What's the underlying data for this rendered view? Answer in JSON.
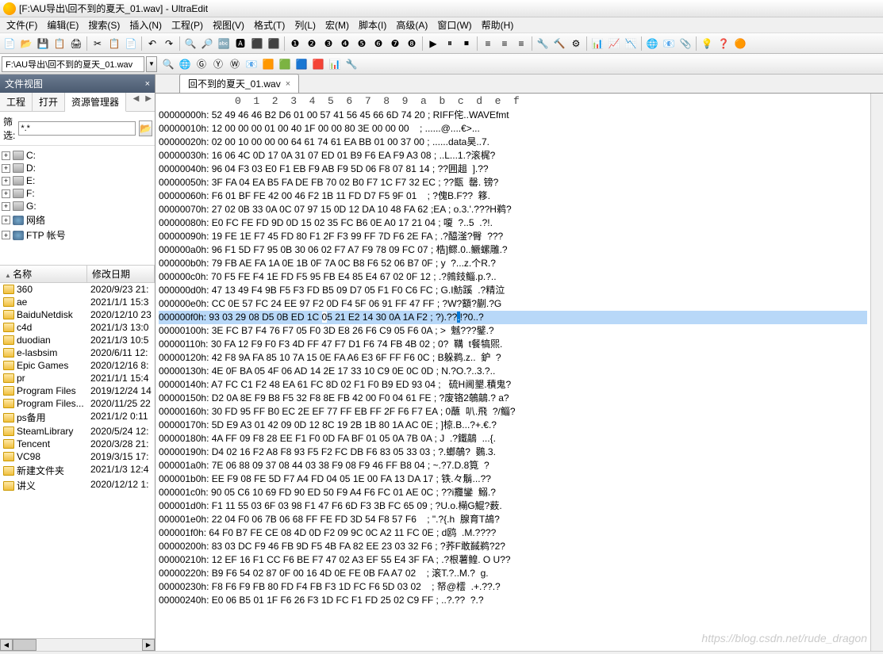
{
  "title": "[F:\\AU导出\\回不到的夏天_01.wav] - UltraEdit",
  "menu": [
    "文件(F)",
    "编辑(E)",
    "搜索(S)",
    "插入(N)",
    "工程(P)",
    "视图(V)",
    "格式(T)",
    "列(L)",
    "宏(M)",
    "脚本(I)",
    "高级(A)",
    "窗口(W)",
    "帮助(H)"
  ],
  "pathbox": "F:\\AU导出\\回不到的夏天_01.wav",
  "sidebar": {
    "title": "文件视图",
    "tabs": [
      "工程",
      "打开",
      "资源管理器"
    ],
    "filter_label": "筛选:",
    "filter_value": "*.*",
    "drives": [
      {
        "label": "C:",
        "icon": "drive"
      },
      {
        "label": "D:",
        "icon": "drive"
      },
      {
        "label": "E:",
        "icon": "drive"
      },
      {
        "label": "F:",
        "icon": "drive"
      },
      {
        "label": "G:",
        "icon": "drive"
      },
      {
        "label": "网络",
        "icon": "net"
      },
      {
        "label": "FTP 帐号",
        "icon": "net"
      }
    ],
    "list_hdr": [
      "名称",
      "修改日期"
    ],
    "files": [
      {
        "n": "360",
        "d": "2020/9/23 21:"
      },
      {
        "n": "ae",
        "d": "2021/1/1 15:3"
      },
      {
        "n": "BaiduNetdisk",
        "d": "2020/12/10 23"
      },
      {
        "n": "c4d",
        "d": "2021/1/3 13:0"
      },
      {
        "n": "duodian",
        "d": "2021/1/3 10:5"
      },
      {
        "n": "e-lasbsim",
        "d": "2020/6/11 12:"
      },
      {
        "n": "Epic Games",
        "d": "2020/12/16 8:"
      },
      {
        "n": "pr",
        "d": "2021/1/1 15:4"
      },
      {
        "n": "Program Files",
        "d": "2019/12/24 14"
      },
      {
        "n": "Program Files...",
        "d": "2020/11/25 22"
      },
      {
        "n": "ps备用",
        "d": "2021/1/2 0:11"
      },
      {
        "n": "SteamLibrary",
        "d": "2020/5/24 12:"
      },
      {
        "n": "Tencent",
        "d": "2020/3/28 21:"
      },
      {
        "n": "VC98",
        "d": "2019/3/15 17:"
      },
      {
        "n": "新建文件夹",
        "d": "2021/1/3 12:4"
      },
      {
        "n": "讲义",
        "d": "2020/12/12 1:"
      }
    ]
  },
  "editor": {
    "tab": "回不到的夏天_01.wav",
    "cols": "0  1  2  3  4  5  6  7  8  9  a  b  c  d  e  f",
    "highlight_row": 15,
    "lines": [
      {
        "a": "00000000h:",
        "h": "52 49 46 46 B2 D6 01 00 57 41 56 45 66 6D 74 20",
        "t": "; RIFF侘..WAVEfmt "
      },
      {
        "a": "00000010h:",
        "h": "12 00 00 00 01 00 40 1F 00 00 80 3E 00 00 00   ",
        "t": "; ......@....€>..."
      },
      {
        "a": "00000020h:",
        "h": "02 00 10 00 00 00 64 61 74 61 EA BB 01 00 37 00",
        "t": "; ......data昊..7."
      },
      {
        "a": "00000030h:",
        "h": "16 06 4C 0D 17 0A 31 07 ED 01 B9 F6 EA F9 A3 08",
        "t": "; ..L...1.?滚梶?"
      },
      {
        "a": "00000040h:",
        "h": "96 04 F3 03 E0 F1 EB F9 AB F9 5D 06 F8 07 81 14",
        "t": "; ??囲趄  ].??"
      },
      {
        "a": "00000050h:",
        "h": "3F FA 04 EA B5 FA DE FB 70 02 B0 F7 1C F7 32 EC",
        "t": "; ??甑  罄. 镑?"
      },
      {
        "a": "00000060h:",
        "h": "F6 01 BF FE 42 00 46 F2 1B 11 FD D7 F5 9F 01   ",
        "t": "; ?傀B.F??  簃."
      },
      {
        "a": "00000070h:",
        "h": "27 02 0B 33 0A 0C 07 97 15 0D 12 DA 10 48 FA 62",
        "t": ";EA ; o.3.'.???H鹈?"
      },
      {
        "a": "00000080h:",
        "h": "E0 FC FE FD 9D 0D 15 02 35 FC B6 0E A0 17 21 04",
        "t": "; 嗄  ?..5  .?!."
      },
      {
        "a": "00000090h:",
        "h": "19 FE 1E F7 45 FD 80 F1 2F F3 99 FF 7D F6 2E FA",
        "t": "; .?醯滏?臀  ???"
      },
      {
        "a": "000000a0h:",
        "h": "96 F1 5D F7 95 0B 30 06 02 F7 A7 F9 78 09 FC 07",
        "t": "; 梏]鳏.0..鳜螺雕.?"
      },
      {
        "a": "000000b0h:",
        "h": "79 FB AE FA 1A 0E 1B 0F 7A 0C B8 F6 52 06 B7 0F",
        "t": "; y  ?...z.个R.?"
      },
      {
        "a": "000000c0h:",
        "h": "70 F5 FE F4 1E FD F5 95 FB E4 85 E4 67 02 0F 12",
        "t": "; .?鶁鈘鲻.p.?.."
      },
      {
        "a": "000000d0h:",
        "h": "47 13 49 F4 9B F5 F3 FD B5 09 D7 05 F1 F0 C6 FC",
        "t": "; G.I魴蹊  .?精泣"
      },
      {
        "a": "000000e0h:",
        "h": "CC 0E 57 FC 24 EE 97 F2 0D F4 5F 06 91 FF 47 FF",
        "t": "; ?W?顮?蒯.?G"
      },
      {
        "a": "000000f0h:",
        "h": "93 03 29 08 D5 0B ED 1C 05 21 E2 14 30 0A 1A F2",
        "t": "; ?).??.!?0..?",
        "sel_before": "93 03 29 08 D5 0B ED 1C ",
        "sel_cell": "0",
        "sel_after": "5 21 E2 14 30 0A 1A F2"
      },
      {
        "a": "00000100h:",
        "h": "3E FC B7 F4 76 F7 05 F0 3D E8 26 F6 C9 05 F6 0A",
        "t": "; >  魊???鐾.?"
      },
      {
        "a": "00000110h:",
        "h": "30 FA 12 F9 F0 F3 4D FF 47 F7 D1 F6 74 FB 4B 02",
        "t": "; 0?  鞲  t餐犒煕."
      },
      {
        "a": "00000120h:",
        "h": "42 F8 9A FA 85 10 7A 15 0E FA A6 E3 6F FF F6 0C",
        "t": "; B躲鹈.z..  鈩  ?"
      },
      {
        "a": "00000130h:",
        "h": "4E 0F BA 05 4F 06 AD 14 2E 17 33 10 C9 0E 0C 0D",
        "t": "; N.?O.?..3.?.."
      },
      {
        "a": "00000140h:",
        "h": "A7 FC C1 F2 48 EA 61 FC 8D 02 F1 F0 B9 ED 93 04",
        "t": ";   硫H阃墾.積鬼?"
      },
      {
        "a": "00000150h:",
        "h": "D2 0A 8E F9 B8 F5 32 F8 8E FB 42 00 F0 04 61 FE",
        "t": "; ?废铬2鵸鶮.? a?"
      },
      {
        "a": "00000160h:",
        "h": "30 FD 95 FF B0 EC 2E EF 77 FF EB FF 2F F6 F7 EA",
        "t": "; 0蘸  叭.飛  ?/鲻?"
      },
      {
        "a": "00000170h:",
        "h": "5D E9 A3 01 42 09 0D 12 8C 19 2B 1B 80 1A AC 0E",
        "t": "; ]椋.B...?+.€.?"
      },
      {
        "a": "00000180h:",
        "h": "4A FF 09 F8 28 EE F1 F0 0D FA BF 01 05 0A 7B 0A",
        "t": "; J  .?鐵鶮  ...{."
      },
      {
        "a": "00000190h:",
        "h": "D4 02 16 F2 A8 F8 93 F5 F2 FC DB F6 83 05 33 03",
        "t": "; ?.螂鵸?  鷃.3."
      },
      {
        "a": "000001a0h:",
        "h": "7E 06 88 09 37 08 44 03 38 F9 08 F9 46 FF B8 04",
        "t": "; ~.?7.D.8筧  ?"
      },
      {
        "a": "000001b0h:",
        "h": "EE F9 08 FE 5D F7 A4 FD 04 05 1E 00 FA 13 DA 17",
        "t": "; 铁.々鬅...??"
      },
      {
        "a": "000001c0h:",
        "h": "90 05 C6 10 69 FD 90 ED 50 F9 A4 F6 FC 01 AE 0C",
        "t": "; ??i龗鑾  鰯.?"
      },
      {
        "a": "000001d0h:",
        "h": "F1 11 55 03 6F 03 98 F1 47 F6 6D F3 3B FC 65 09",
        "t": "; ?U.o.橗G鯤?薮."
      },
      {
        "a": "000001e0h:",
        "h": "22 04 F0 06 7B 06 68 FF FE FD 3D 54 F8 57 F6   ",
        "t": "; \".?{.h  腺育T鴣?"
      },
      {
        "a": "000001f0h:",
        "h": "64 F0 B7 FE CE 08 4D 0D F2 09 9C 0C A2 11 FC 0E",
        "t": "; d鸥  .M.????"
      },
      {
        "a": "00000200h:",
        "h": "83 03 DC F9 46 FB 9D F5 4B FA 82 EE 23 03 32 F6",
        "t": "; ?荞F敢馘鹈?2?"
      },
      {
        "a": "00000210h:",
        "h": "12 EF 16 F1 CC F6 BE F7 47 02 A3 EF 55 E4 3F FA",
        "t": "; .?根薯鳇. O U??"
      },
      {
        "a": "00000220h:",
        "h": "B9 F6 54 02 87 0F 00 16 4D 0E FE 0B FA A7 02   ",
        "t": "; 滚T.?..M.?  g."
      },
      {
        "a": "00000230h:",
        "h": "F8 F6 F9 FB 80 FD F4 FB F3 1D FC F6 5D 03 02   ",
        "t": "; 帑@橒  .+.??.?"
      },
      {
        "a": "00000240h:",
        "h": "E0 06 B5 01 1F F6 26 F3 1D FC F1 FD 25 02 C9 FF",
        "t": "; ..?.??  ?.?"
      }
    ]
  },
  "watermark": "https://blog.csdn.net/rude_dragon"
}
